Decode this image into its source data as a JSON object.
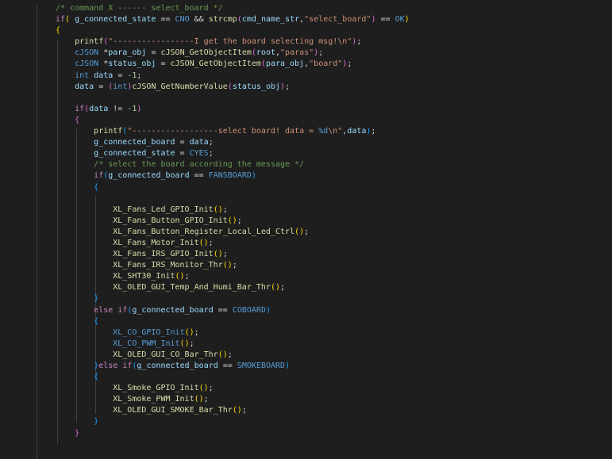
{
  "editor": {
    "lines": [
      [
        {
          "t": "/* command X ------ select_board */",
          "c": "c-comment"
        }
      ],
      [
        {
          "t": "if",
          "c": "c-keyword"
        },
        {
          "t": "( ",
          "c": "c-brace1"
        },
        {
          "t": "g_connected_state",
          "c": "c-var"
        },
        {
          "t": " == ",
          "c": "c-plain"
        },
        {
          "t": "CNO",
          "c": "c-macro"
        },
        {
          "t": " && ",
          "c": "c-plain"
        },
        {
          "t": "strcmp",
          "c": "c-func"
        },
        {
          "t": "(",
          "c": "c-brace2"
        },
        {
          "t": "cmd_name_str",
          "c": "c-var"
        },
        {
          "t": ",",
          "c": "c-plain"
        },
        {
          "t": "\"select_board\"",
          "c": "c-str"
        },
        {
          "t": ")",
          "c": "c-brace2"
        },
        {
          "t": " == ",
          "c": "c-plain"
        },
        {
          "t": "OK",
          "c": "c-macro"
        },
        {
          "t": ")",
          "c": "c-brace1"
        }
      ],
      [
        {
          "t": "{",
          "c": "c-brace1"
        }
      ],
      [
        {
          "t": "    ",
          "c": "c-plain"
        },
        {
          "t": "printf",
          "c": "c-func"
        },
        {
          "t": "(",
          "c": "c-brace2"
        },
        {
          "t": "\"-----------------I get the board selecting msg!\\n\"",
          "c": "c-str"
        },
        {
          "t": ")",
          "c": "c-brace2"
        },
        {
          "t": ";",
          "c": "c-plain"
        }
      ],
      [
        {
          "t": "    ",
          "c": "c-plain"
        },
        {
          "t": "cJSON",
          "c": "c-type"
        },
        {
          "t": " *",
          "c": "c-plain"
        },
        {
          "t": "para_obj",
          "c": "c-var"
        },
        {
          "t": " = ",
          "c": "c-plain"
        },
        {
          "t": "cJSON_GetObjectItem",
          "c": "c-func"
        },
        {
          "t": "(",
          "c": "c-brace2"
        },
        {
          "t": "root",
          "c": "c-var"
        },
        {
          "t": ",",
          "c": "c-plain"
        },
        {
          "t": "\"paras\"",
          "c": "c-str"
        },
        {
          "t": ")",
          "c": "c-brace2"
        },
        {
          "t": ";",
          "c": "c-plain"
        }
      ],
      [
        {
          "t": "    ",
          "c": "c-plain"
        },
        {
          "t": "cJSON",
          "c": "c-type"
        },
        {
          "t": " *",
          "c": "c-plain"
        },
        {
          "t": "status_obj",
          "c": "c-var"
        },
        {
          "t": " = ",
          "c": "c-plain"
        },
        {
          "t": "cJSON_GetObjectItem",
          "c": "c-func"
        },
        {
          "t": "(",
          "c": "c-brace2"
        },
        {
          "t": "para_obj",
          "c": "c-var"
        },
        {
          "t": ",",
          "c": "c-plain"
        },
        {
          "t": "\"board\"",
          "c": "c-str"
        },
        {
          "t": ")",
          "c": "c-brace2"
        },
        {
          "t": ";",
          "c": "c-plain"
        }
      ],
      [
        {
          "t": "    ",
          "c": "c-plain"
        },
        {
          "t": "int",
          "c": "c-type"
        },
        {
          "t": " ",
          "c": "c-plain"
        },
        {
          "t": "data",
          "c": "c-var"
        },
        {
          "t": " = ",
          "c": "c-plain"
        },
        {
          "t": "-1",
          "c": "c-num"
        },
        {
          "t": ";",
          "c": "c-plain"
        }
      ],
      [
        {
          "t": "    ",
          "c": "c-plain"
        },
        {
          "t": "data",
          "c": "c-var"
        },
        {
          "t": " = ",
          "c": "c-plain"
        },
        {
          "t": "(",
          "c": "c-brace2"
        },
        {
          "t": "int",
          "c": "c-type"
        },
        {
          "t": ")",
          "c": "c-brace2"
        },
        {
          "t": "cJSON_GetNumberValue",
          "c": "c-func"
        },
        {
          "t": "(",
          "c": "c-brace2"
        },
        {
          "t": "status_obj",
          "c": "c-var"
        },
        {
          "t": ")",
          "c": "c-brace2"
        },
        {
          "t": ";",
          "c": "c-plain"
        }
      ],
      [],
      [
        {
          "t": "    ",
          "c": "c-plain"
        },
        {
          "t": "if",
          "c": "c-keyword"
        },
        {
          "t": "(",
          "c": "c-brace2"
        },
        {
          "t": "data",
          "c": "c-var"
        },
        {
          "t": " != ",
          "c": "c-plain"
        },
        {
          "t": "-1",
          "c": "c-num"
        },
        {
          "t": ")",
          "c": "c-brace2"
        }
      ],
      [
        {
          "t": "    ",
          "c": "c-plain"
        },
        {
          "t": "{",
          "c": "c-brace2"
        }
      ],
      [
        {
          "t": "        ",
          "c": "c-plain"
        },
        {
          "t": "printf",
          "c": "c-func"
        },
        {
          "t": "(",
          "c": "c-brace3"
        },
        {
          "t": "\"------------------select board! data = ",
          "c": "c-str"
        },
        {
          "t": "%d",
          "c": "c-type"
        },
        {
          "t": "\\n\"",
          "c": "c-str"
        },
        {
          "t": ",",
          "c": "c-plain"
        },
        {
          "t": "data",
          "c": "c-var"
        },
        {
          "t": ")",
          "c": "c-brace3"
        },
        {
          "t": ";",
          "c": "c-plain"
        }
      ],
      [
        {
          "t": "        ",
          "c": "c-plain"
        },
        {
          "t": "g_connected_board",
          "c": "c-var"
        },
        {
          "t": " = ",
          "c": "c-plain"
        },
        {
          "t": "data",
          "c": "c-var"
        },
        {
          "t": ";",
          "c": "c-plain"
        }
      ],
      [
        {
          "t": "        ",
          "c": "c-plain"
        },
        {
          "t": "g_connected_state",
          "c": "c-var"
        },
        {
          "t": " = ",
          "c": "c-plain"
        },
        {
          "t": "CYES",
          "c": "c-macro"
        },
        {
          "t": ";",
          "c": "c-plain"
        }
      ],
      [
        {
          "t": "        ",
          "c": "c-plain"
        },
        {
          "t": "/* select the board according the message */",
          "c": "c-comment"
        }
      ],
      [
        {
          "t": "        ",
          "c": "c-plain"
        },
        {
          "t": "if",
          "c": "c-keyword"
        },
        {
          "t": "(",
          "c": "c-brace3"
        },
        {
          "t": "g_connected_board",
          "c": "c-var"
        },
        {
          "t": " == ",
          "c": "c-plain"
        },
        {
          "t": "FANSBOARD",
          "c": "c-macro"
        },
        {
          "t": ")",
          "c": "c-brace3"
        }
      ],
      [
        {
          "t": "        ",
          "c": "c-plain"
        },
        {
          "t": "{",
          "c": "c-brace3"
        }
      ],
      [],
      [
        {
          "t": "            ",
          "c": "c-plain"
        },
        {
          "t": "XL_Fans_Led_GPIO_Init",
          "c": "c-func"
        },
        {
          "t": "()",
          "c": "c-brace1"
        },
        {
          "t": ";",
          "c": "c-plain"
        }
      ],
      [
        {
          "t": "            ",
          "c": "c-plain"
        },
        {
          "t": "XL_Fans_Button_GPIO_Init",
          "c": "c-func"
        },
        {
          "t": "()",
          "c": "c-brace1"
        },
        {
          "t": ";",
          "c": "c-plain"
        }
      ],
      [
        {
          "t": "            ",
          "c": "c-plain"
        },
        {
          "t": "XL_Fans_Button_Register_Local_Led_Ctrl",
          "c": "c-func"
        },
        {
          "t": "()",
          "c": "c-brace1"
        },
        {
          "t": ";",
          "c": "c-plain"
        }
      ],
      [
        {
          "t": "            ",
          "c": "c-plain"
        },
        {
          "t": "XL_Fans_Motor_Init",
          "c": "c-func"
        },
        {
          "t": "()",
          "c": "c-brace1"
        },
        {
          "t": ";",
          "c": "c-plain"
        }
      ],
      [
        {
          "t": "            ",
          "c": "c-plain"
        },
        {
          "t": "XL_Fans_IRS_GPIO_Init",
          "c": "c-func"
        },
        {
          "t": "()",
          "c": "c-brace1"
        },
        {
          "t": ";",
          "c": "c-plain"
        }
      ],
      [
        {
          "t": "            ",
          "c": "c-plain"
        },
        {
          "t": "XL_Fans_IRS_Monitor_Thr",
          "c": "c-func"
        },
        {
          "t": "()",
          "c": "c-brace1"
        },
        {
          "t": ";",
          "c": "c-plain"
        }
      ],
      [
        {
          "t": "            ",
          "c": "c-plain"
        },
        {
          "t": "XL_SHT30_Init",
          "c": "c-func"
        },
        {
          "t": "()",
          "c": "c-brace1"
        },
        {
          "t": ";",
          "c": "c-plain"
        }
      ],
      [
        {
          "t": "            ",
          "c": "c-plain"
        },
        {
          "t": "XL_OLED_GUI_Temp_And_Humi_Bar_Thr",
          "c": "c-func"
        },
        {
          "t": "()",
          "c": "c-brace1"
        },
        {
          "t": ";",
          "c": "c-plain"
        }
      ],
      [
        {
          "t": "        ",
          "c": "c-plain"
        },
        {
          "t": "}",
          "c": "c-brace3"
        }
      ],
      [
        {
          "t": "        ",
          "c": "c-plain"
        },
        {
          "t": "else",
          "c": "c-keyword"
        },
        {
          "t": " ",
          "c": "c-plain"
        },
        {
          "t": "if",
          "c": "c-keyword"
        },
        {
          "t": "(",
          "c": "c-brace3"
        },
        {
          "t": "g_connected_board",
          "c": "c-var"
        },
        {
          "t": " == ",
          "c": "c-plain"
        },
        {
          "t": "COBOARD",
          "c": "c-macro"
        },
        {
          "t": ")",
          "c": "c-brace3"
        }
      ],
      [
        {
          "t": "        ",
          "c": "c-plain"
        },
        {
          "t": "{",
          "c": "c-brace3"
        }
      ],
      [
        {
          "t": "            ",
          "c": "c-plain"
        },
        {
          "t": "XL_CO_GPIO_Init",
          "c": "c-type"
        },
        {
          "t": "()",
          "c": "c-brace1"
        },
        {
          "t": ";",
          "c": "c-plain"
        }
      ],
      [
        {
          "t": "            ",
          "c": "c-plain"
        },
        {
          "t": "XL_CO_PWM_Init",
          "c": "c-type"
        },
        {
          "t": "()",
          "c": "c-brace1"
        },
        {
          "t": ";",
          "c": "c-plain"
        }
      ],
      [
        {
          "t": "            ",
          "c": "c-plain"
        },
        {
          "t": "XL_OLED_GUI_CO_Bar_Thr",
          "c": "c-func"
        },
        {
          "t": "()",
          "c": "c-brace1"
        },
        {
          "t": ";",
          "c": "c-plain"
        }
      ],
      [
        {
          "t": "        ",
          "c": "c-plain"
        },
        {
          "t": "}",
          "c": "c-brace3"
        },
        {
          "t": "else",
          "c": "c-keyword"
        },
        {
          "t": " ",
          "c": "c-plain"
        },
        {
          "t": "if",
          "c": "c-keyword"
        },
        {
          "t": "(",
          "c": "c-brace3"
        },
        {
          "t": "g_connected_board",
          "c": "c-var"
        },
        {
          "t": " == ",
          "c": "c-plain"
        },
        {
          "t": "SMOKEBOARD",
          "c": "c-macro"
        },
        {
          "t": ")",
          "c": "c-brace3"
        }
      ],
      [
        {
          "t": "        ",
          "c": "c-plain"
        },
        {
          "t": "{",
          "c": "c-brace3"
        }
      ],
      [
        {
          "t": "            ",
          "c": "c-plain"
        },
        {
          "t": "XL_Smoke_GPIO_Init",
          "c": "c-func"
        },
        {
          "t": "()",
          "c": "c-brace1"
        },
        {
          "t": ";",
          "c": "c-plain"
        }
      ],
      [
        {
          "t": "            ",
          "c": "c-plain"
        },
        {
          "t": "XL_Smoke_PWM_Init",
          "c": "c-func"
        },
        {
          "t": "()",
          "c": "c-brace1"
        },
        {
          "t": ";",
          "c": "c-plain"
        }
      ],
      [
        {
          "t": "            ",
          "c": "c-plain"
        },
        {
          "t": "XL_OLED_GUI_SMOKE_Bar_Thr",
          "c": "c-func"
        },
        {
          "t": "()",
          "c": "c-brace1"
        },
        {
          "t": ";",
          "c": "c-plain"
        }
      ],
      [
        {
          "t": "        ",
          "c": "c-plain"
        },
        {
          "t": "}",
          "c": "c-brace3"
        }
      ],
      [
        {
          "t": "    ",
          "c": "c-plain"
        },
        {
          "t": "}",
          "c": "c-brace2"
        }
      ],
      [],
      [],
      [
        {
          "t": "}",
          "c": "c-brace1"
        }
      ]
    ]
  }
}
